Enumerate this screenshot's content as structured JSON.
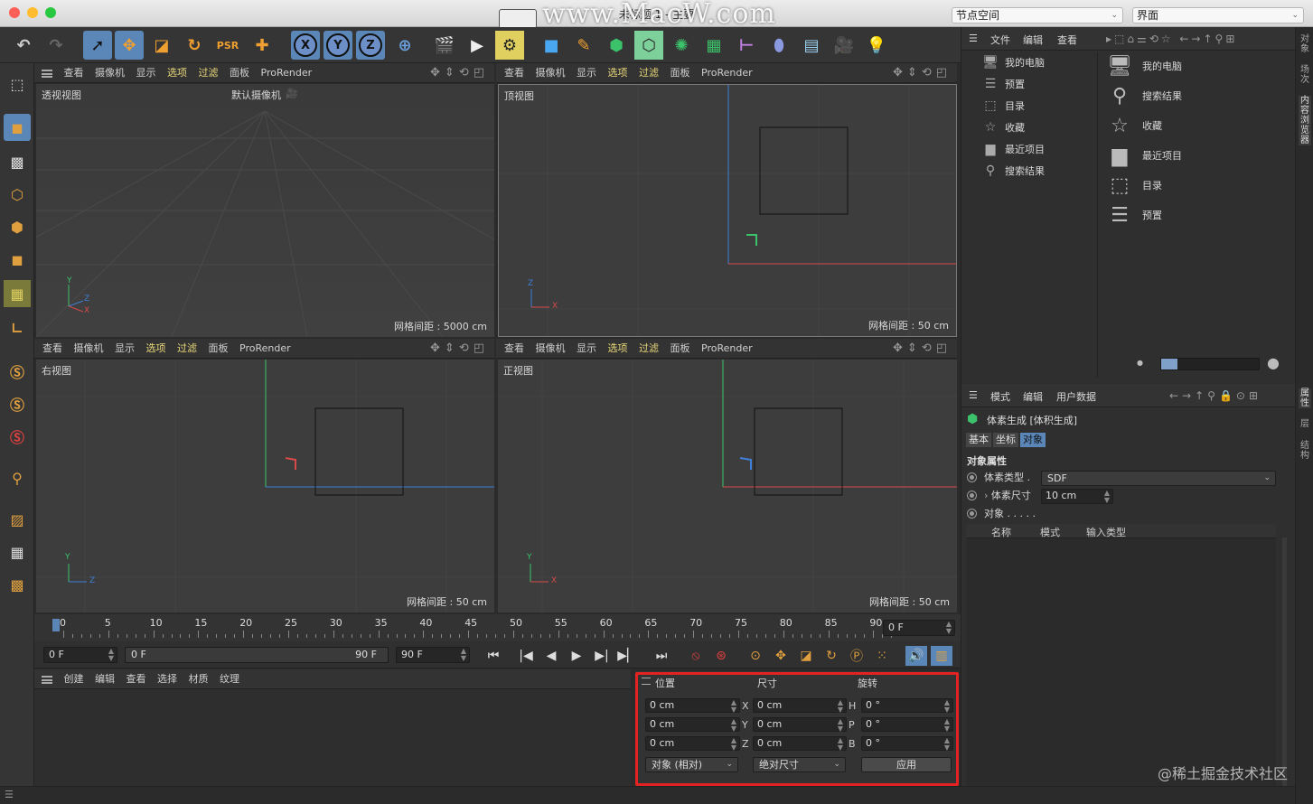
{
  "window": {
    "title": "未标题 1 - 主要",
    "watermark": "www.MacW.com",
    "node_space": "节点空间",
    "layout": "界面"
  },
  "viewport_menu": [
    "查看",
    "摄像机",
    "显示",
    "选项",
    "过滤",
    "面板",
    "ProRender"
  ],
  "viewports": {
    "perspective": {
      "label": "透视视图",
      "camera": "默认摄像机",
      "grid": "网格间距 : 5000 cm",
      "axes": [
        "Y",
        "Z",
        "X"
      ]
    },
    "top": {
      "label": "顶视图",
      "grid": "网格间距 : 50 cm",
      "axes": [
        "Z",
        "X"
      ]
    },
    "right": {
      "label": "右视图",
      "grid": "网格间距 : 50 cm",
      "axes": [
        "Y",
        "Z"
      ]
    },
    "front": {
      "label": "正视图",
      "grid": "网格间距 : 50 cm",
      "axes": [
        "Y",
        "X"
      ]
    }
  },
  "timeline": {
    "ticks": [
      "0",
      "5",
      "10",
      "15",
      "20",
      "25",
      "30",
      "35",
      "40",
      "45",
      "50",
      "55",
      "60",
      "65",
      "70",
      "75",
      "80",
      "85",
      "90"
    ],
    "current_frame": "0 F",
    "start": "0 F",
    "range_start": "0 F",
    "range_end": "90 F",
    "end": "90 F"
  },
  "material_menu": [
    "创建",
    "编辑",
    "查看",
    "选择",
    "材质",
    "纹理"
  ],
  "coordinates": {
    "headers": {
      "position": "位置",
      "size": "尺寸",
      "rotation": "旋转"
    },
    "rows": [
      {
        "axis": "X",
        "pos": "0 cm",
        "size": "0 cm",
        "rot_label": "H",
        "rot": "0 °"
      },
      {
        "axis": "Y",
        "pos": "0 cm",
        "size": "0 cm",
        "rot_label": "P",
        "rot": "0 °"
      },
      {
        "axis": "Z",
        "pos": "0 cm",
        "size": "0 cm",
        "rot_label": "B",
        "rot": "0 °"
      }
    ],
    "mode": "对象 (相对)",
    "size_mode": "绝对尺寸",
    "apply": "应用"
  },
  "browser": {
    "menu": [
      "文件",
      "编辑",
      "查看"
    ],
    "tree": [
      {
        "label": "我的电脑",
        "icon": "monitor-icon"
      },
      {
        "label": "预置",
        "icon": "presets-icon"
      },
      {
        "label": "目录",
        "icon": "catalog-icon"
      },
      {
        "label": "收藏",
        "icon": "star-icon"
      },
      {
        "label": "最近项目",
        "icon": "folder-icon"
      },
      {
        "label": "搜索结果",
        "icon": "search-icon"
      }
    ],
    "items": [
      {
        "label": "我的电脑",
        "icon": "monitor-icon"
      },
      {
        "label": "搜索结果",
        "icon": "search-icon"
      },
      {
        "label": "收藏",
        "icon": "star-icon"
      },
      {
        "label": "最近项目",
        "icon": "folder-icon"
      },
      {
        "label": "目录",
        "icon": "catalog-icon"
      },
      {
        "label": "预置",
        "icon": "presets-icon"
      }
    ]
  },
  "attributes": {
    "menu": [
      "模式",
      "编辑",
      "用户数据"
    ],
    "object_name": "体素生成 [体积生成]",
    "tabs": [
      "基本",
      "坐标",
      "对象"
    ],
    "active_tab": "对象",
    "section": "对象属性",
    "voxel_type_label": "体素类型 .",
    "voxel_type": "SDF",
    "voxel_size_label": "体素尺寸",
    "voxel_size": "10 cm",
    "objects_label": "对象 . . . . .",
    "columns": [
      "名称",
      "模式",
      "输入类型"
    ]
  },
  "side_tabs": [
    "对象",
    "场次",
    "内容浏览器",
    "属性",
    "层",
    "结构"
  ],
  "credit": "@稀土掘金技术社区",
  "colors": {
    "accent": "#5a86b8",
    "highlight_menu": "#e8d879",
    "red_box": "#e32222",
    "axis_x": "#d84a4a",
    "axis_y": "#3cc26a",
    "axis_z": "#3f7fd8"
  }
}
